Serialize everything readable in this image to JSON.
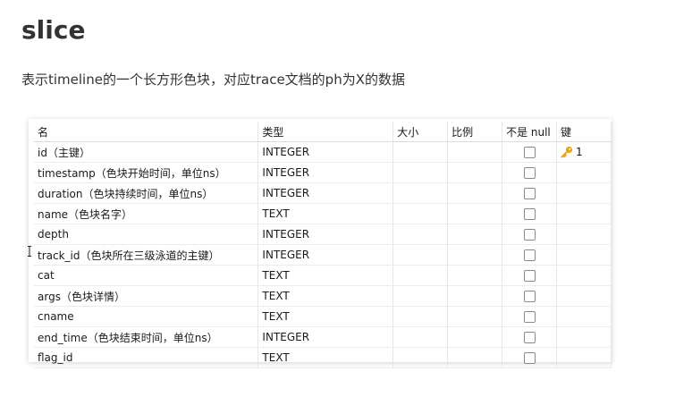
{
  "title": "slice",
  "description": "表示timeline的一个长方形色块，对应trace文档的ph为X的数据",
  "table": {
    "headers": {
      "name": "名",
      "type": "类型",
      "size": "大小",
      "scale": "比例",
      "not_null": "不是 null",
      "key": "键"
    },
    "rows": [
      {
        "name": "id（主键）",
        "type": "INTEGER",
        "key": "1",
        "key_icon": "key-icon"
      },
      {
        "name": "timestamp（色块开始时间，单位ns）",
        "type": "INTEGER",
        "key": ""
      },
      {
        "name": "duration（色块持续时间，单位ns）",
        "type": "INTEGER",
        "key": ""
      },
      {
        "name": "name（色块名字）",
        "type": "TEXT",
        "key": ""
      },
      {
        "name": "depth",
        "type": "INTEGER",
        "key": ""
      },
      {
        "name": "track_id（色块所在三级泳道的主键）",
        "type": "INTEGER",
        "key": ""
      },
      {
        "name": "cat",
        "type": "TEXT",
        "key": ""
      },
      {
        "name": "args（色块详情）",
        "type": "TEXT",
        "key": ""
      },
      {
        "name": "cname",
        "type": "TEXT",
        "key": ""
      },
      {
        "name": "end_time（色块结束时间，单位ns）",
        "type": "INTEGER",
        "key": ""
      },
      {
        "name": "flag_id",
        "type": "TEXT",
        "key": ""
      }
    ]
  },
  "colors": {
    "key_icon": "#e8a317",
    "text": "#1a1a1a"
  }
}
